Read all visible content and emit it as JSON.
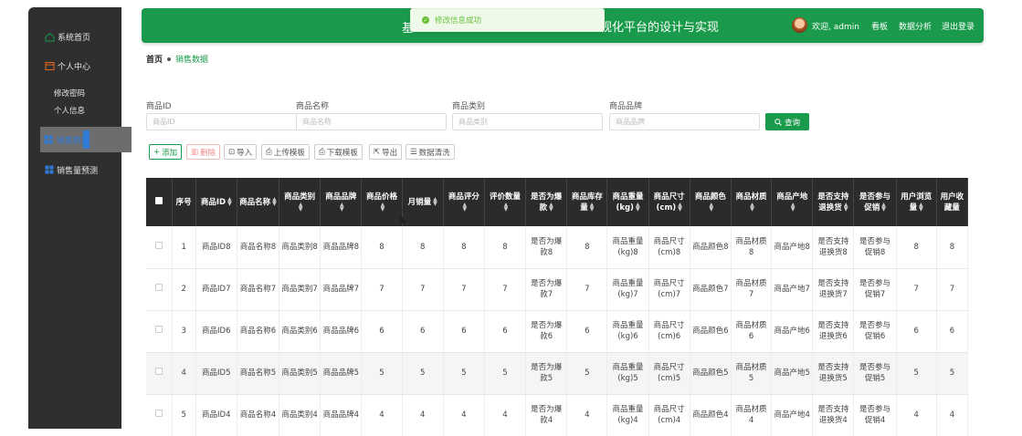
{
  "sidebar": {
    "items": [
      {
        "label": "系统首页",
        "icon": "home-icon"
      },
      {
        "label": "个人中心",
        "icon": "user-panel-icon"
      },
      {
        "label": "销售数据",
        "icon": "grid-icon"
      },
      {
        "label": "销售量预测",
        "icon": "grid-icon"
      }
    ],
    "sub_items": [
      "修改密码",
      "个人信息"
    ],
    "active_label_visible": "销售数据"
  },
  "header": {
    "title_left": "基",
    "title_right": "视化平台的设计与实现",
    "welcome": "欢迎, admin",
    "links": [
      "看板",
      "数据分析",
      "退出登录"
    ]
  },
  "toast": {
    "message": "修改信息成功"
  },
  "breadcrumb": {
    "home": "首页",
    "current": "销售数据"
  },
  "search": {
    "fields": [
      {
        "label": "商品ID",
        "placeholder": "商品ID"
      },
      {
        "label": "商品名称",
        "placeholder": "商品名称"
      },
      {
        "label": "商品类别",
        "placeholder": "商品类别"
      },
      {
        "label": "商品品牌",
        "placeholder": "商品品牌"
      }
    ],
    "query_label": "查询"
  },
  "toolbar": {
    "add": "添加",
    "delete": "删除",
    "import": "导入",
    "upload_template": "上传模板",
    "download_template": "下载模板",
    "export": "导出",
    "clear": "数据清洗"
  },
  "table": {
    "headers": [
      "序号",
      "商品ID",
      "商品名称",
      "商品类别",
      "商品品牌",
      "商品价格",
      "月销量",
      "商品评分",
      "评价数量",
      "是否为爆款",
      "商品库存量",
      "商品重量(kg)",
      "商品尺寸(cm)",
      "商品颜色",
      "商品材质",
      "商品产地",
      "是否支持退换货",
      "是否参与促销",
      "用户浏览量",
      "用户收藏量"
    ],
    "rows": [
      [
        "1",
        "商品ID8",
        "商品名称8",
        "商品类别8",
        "商品品牌8",
        "8",
        "8",
        "8",
        "8",
        "是否为爆款8",
        "8",
        "商品重量(kg)8",
        "商品尺寸(cm)8",
        "商品颜色8",
        "商品材质8",
        "商品产地8",
        "是否支持退换货8",
        "是否参与促销8",
        "8",
        "8"
      ],
      [
        "2",
        "商品ID7",
        "商品名称7",
        "商品类别7",
        "商品品牌7",
        "7",
        "7",
        "7",
        "7",
        "是否为爆款7",
        "7",
        "商品重量(kg)7",
        "商品尺寸(cm)7",
        "商品颜色7",
        "商品材质7",
        "商品产地7",
        "是否支持退换货7",
        "是否参与促销7",
        "7",
        "7"
      ],
      [
        "3",
        "商品ID6",
        "商品名称6",
        "商品类别6",
        "商品品牌6",
        "6",
        "6",
        "6",
        "6",
        "是否为爆款6",
        "6",
        "商品重量(kg)6",
        "商品尺寸(cm)6",
        "商品颜色6",
        "商品材质6",
        "商品产地6",
        "是否支持退换货6",
        "是否参与促销6",
        "6",
        "6"
      ],
      [
        "4",
        "商品ID5",
        "商品名称5",
        "商品类别5",
        "商品品牌5",
        "5",
        "5",
        "5",
        "5",
        "是否为爆款5",
        "5",
        "商品重量(kg)5",
        "商品尺寸(cm)5",
        "商品颜色5",
        "商品材质5",
        "商品产地5",
        "是否支持退换货5",
        "是否参与促销5",
        "5",
        "5"
      ],
      [
        "5",
        "商品ID4",
        "商品名称4",
        "商品类别4",
        "商品品牌4",
        "4",
        "4",
        "4",
        "4",
        "是否为爆款4",
        "4",
        "商品重量(kg)4",
        "商品尺寸(cm)4",
        "商品颜色4",
        "商品材质4",
        "商品产地4",
        "是否支持退换货4",
        "是否参与促销4",
        "4",
        "4"
      ]
    ]
  },
  "colors": {
    "brand_green": "#1a9a4b",
    "sidebar_bg": "#2f2f2f",
    "active_blue": "#2f7bd6",
    "toast_green": "#67c23a"
  }
}
